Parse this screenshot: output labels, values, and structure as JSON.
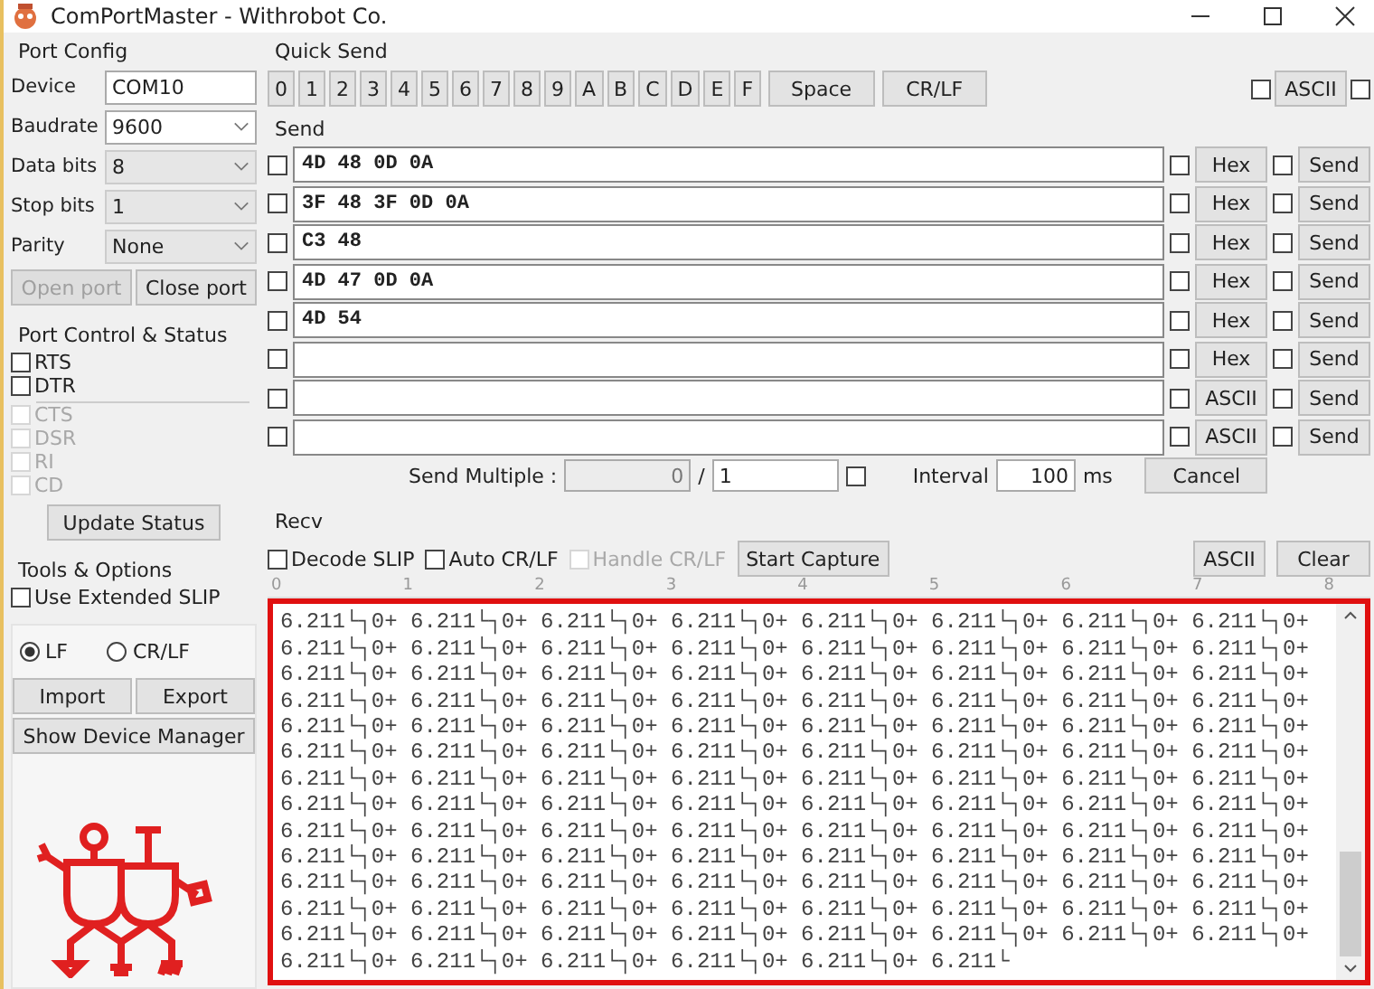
{
  "window": {
    "title": "ComPortMaster - Withrobot Co."
  },
  "port_config": {
    "title": "Port Config",
    "fields": [
      {
        "label": "Device",
        "value": "COM10",
        "kind": "text",
        "disabled": false
      },
      {
        "label": "Baudrate",
        "value": "9600",
        "kind": "combo",
        "disabled": false
      },
      {
        "label": "Data bits",
        "value": "8",
        "kind": "combo",
        "disabled": true
      },
      {
        "label": "Stop bits",
        "value": "1",
        "kind": "combo",
        "disabled": true
      },
      {
        "label": "Parity",
        "value": "None",
        "kind": "combo",
        "disabled": true
      }
    ],
    "buttons": [
      {
        "label": "Open port",
        "disabled": true
      },
      {
        "label": "Close port",
        "disabled": false
      }
    ]
  },
  "port_control": {
    "title": "Port Control & Status",
    "outputs": [
      {
        "label": "RTS",
        "checked": false
      },
      {
        "label": "DTR",
        "checked": false
      }
    ],
    "inputs": [
      {
        "label": "CTS",
        "checked": false
      },
      {
        "label": "DSR",
        "checked": false
      },
      {
        "label": "RI",
        "checked": false
      },
      {
        "label": "CD",
        "checked": false
      }
    ],
    "update_button": "Update Status"
  },
  "tools": {
    "title": "Tools & Options",
    "extended_slip": {
      "label": "Use Extended SLIP",
      "checked": false
    },
    "line_endings": [
      {
        "label": "LF",
        "selected": true
      },
      {
        "label": "CR/LF",
        "selected": false
      }
    ],
    "buttons": [
      "Import",
      "Export"
    ],
    "device_manager_button": "Show Device Manager"
  },
  "quick_send": {
    "title": "Quick Send",
    "keys": [
      "0",
      "1",
      "2",
      "3",
      "4",
      "5",
      "6",
      "7",
      "8",
      "9",
      "A",
      "B",
      "C",
      "D",
      "E",
      "F",
      "Space",
      "CR/LF"
    ],
    "ascii_checked": false,
    "mode_button": "ASCII",
    "extra_checked": false
  },
  "send": {
    "title": "Send",
    "rows": [
      {
        "checked": false,
        "value": "4D 48 0D 0A",
        "mode_checked": false,
        "mode": "Hex",
        "send_checked": false,
        "send": "Send"
      },
      {
        "checked": false,
        "value": "3F 48 3F 0D 0A",
        "mode_checked": false,
        "mode": "Hex",
        "send_checked": false,
        "send": "Send"
      },
      {
        "checked": false,
        "value": "C3 48",
        "mode_checked": false,
        "mode": "Hex",
        "send_checked": false,
        "send": "Send"
      },
      {
        "checked": false,
        "value": "4D 47 0D 0A",
        "mode_checked": false,
        "mode": "Hex",
        "send_checked": false,
        "send": "Send"
      },
      {
        "checked": false,
        "value": "4D 54",
        "mode_checked": false,
        "mode": "Hex",
        "send_checked": false,
        "send": "Send"
      },
      {
        "checked": false,
        "value": "",
        "mode_checked": false,
        "mode": "Hex",
        "send_checked": false,
        "send": "Send"
      },
      {
        "checked": false,
        "value": "",
        "mode_checked": false,
        "mode": "ASCII",
        "send_checked": false,
        "send": "Send"
      },
      {
        "checked": false,
        "value": "",
        "mode_checked": false,
        "mode": "ASCII",
        "send_checked": false,
        "send": "Send"
      }
    ],
    "multiple_label": "Send Multiple :",
    "multiple_count": "0",
    "separator": "/",
    "multiple_total": "1",
    "repeat_checked": false,
    "interval_label": "Interval",
    "interval": "100",
    "interval_unit": "ms",
    "cancel_button": "Cancel"
  },
  "recv": {
    "title": "Recv",
    "options": [
      {
        "label": "Decode SLIP",
        "checked": false,
        "disabled": false
      },
      {
        "label": "Auto CR/LF",
        "checked": false,
        "disabled": false
      },
      {
        "label": "Handle CR/LF",
        "checked": false,
        "disabled": true
      }
    ],
    "capture_button": "Start Capture",
    "mode_button": "ASCII",
    "clear_button": "Clear",
    "ruler": [
      "0",
      "1",
      "2",
      "3",
      "4",
      "5",
      "6",
      "7",
      "8"
    ],
    "highlighted": true,
    "lines": [
      "6.211└┐0+ 6.211└┐0+ 6.211└┐0+ 6.211└┐0+ 6.211└┐0+ 6.211└┐0+ 6.211└┐0+ 6.211└┐0+",
      "6.211└┐0+ 6.211└┐0+ 6.211└┐0+ 6.211└┐0+ 6.211└┐0+ 6.211└┐0+ 6.211└┐0+ 6.211└┐0+",
      "6.211└┐0+ 6.211└┐0+ 6.211└┐0+ 6.211└┐0+ 6.211└┐0+ 6.211└┐0+ 6.211└┐0+ 6.211└┐0+",
      "6.211└┐0+ 6.211└┐0+ 6.211└┐0+ 6.211└┐0+ 6.211└┐0+ 6.211└┐0+ 6.211└┐0+ 6.211└┐0+",
      "6.211└┐0+ 6.211└┐0+ 6.211└┐0+ 6.211└┐0+ 6.211└┐0+ 6.211└┐0+ 6.211└┐0+ 6.211└┐0+",
      "6.211└┐0+ 6.211└┐0+ 6.211└┐0+ 6.211└┐0+ 6.211└┐0+ 6.211└┐0+ 6.211└┐0+ 6.211└┐0+",
      "6.211└┐0+ 6.211└┐0+ 6.211└┐0+ 6.211└┐0+ 6.211└┐0+ 6.211└┐0+ 6.211└┐0+ 6.211└┐0+",
      "6.211└┐0+ 6.211└┐0+ 6.211└┐0+ 6.211└┐0+ 6.211└┐0+ 6.211└┐0+ 6.211└┐0+ 6.211└┐0+",
      "6.211└┐0+ 6.211└┐0+ 6.211└┐0+ 6.211└┐0+ 6.211└┐0+ 6.211└┐0+ 6.211└┐0+ 6.211└┐0+",
      "6.211└┐0+ 6.211└┐0+ 6.211└┐0+ 6.211└┐0+ 6.211└┐0+ 6.211└┐0+ 6.211└┐0+ 6.211└┐0+",
      "6.211└┐0+ 6.211└┐0+ 6.211└┐0+ 6.211└┐0+ 6.211└┐0+ 6.211└┐0+ 6.211└┐0+ 6.211└┐0+",
      "6.211└┐0+ 6.211└┐0+ 6.211└┐0+ 6.211└┐0+ 6.211└┐0+ 6.211└┐0+ 6.211└┐0+ 6.211└┐0+",
      "6.211└┐0+ 6.211└┐0+ 6.211└┐0+ 6.211└┐0+ 6.211└┐0+ 6.211└┐0+ 6.211└┐0+ 6.211└┐0+",
      "6.211└┐0+ 6.211└┐0+ 6.211└┐0+ 6.211└┐0+ 6.211└┐0+ 6.211└"
    ]
  }
}
